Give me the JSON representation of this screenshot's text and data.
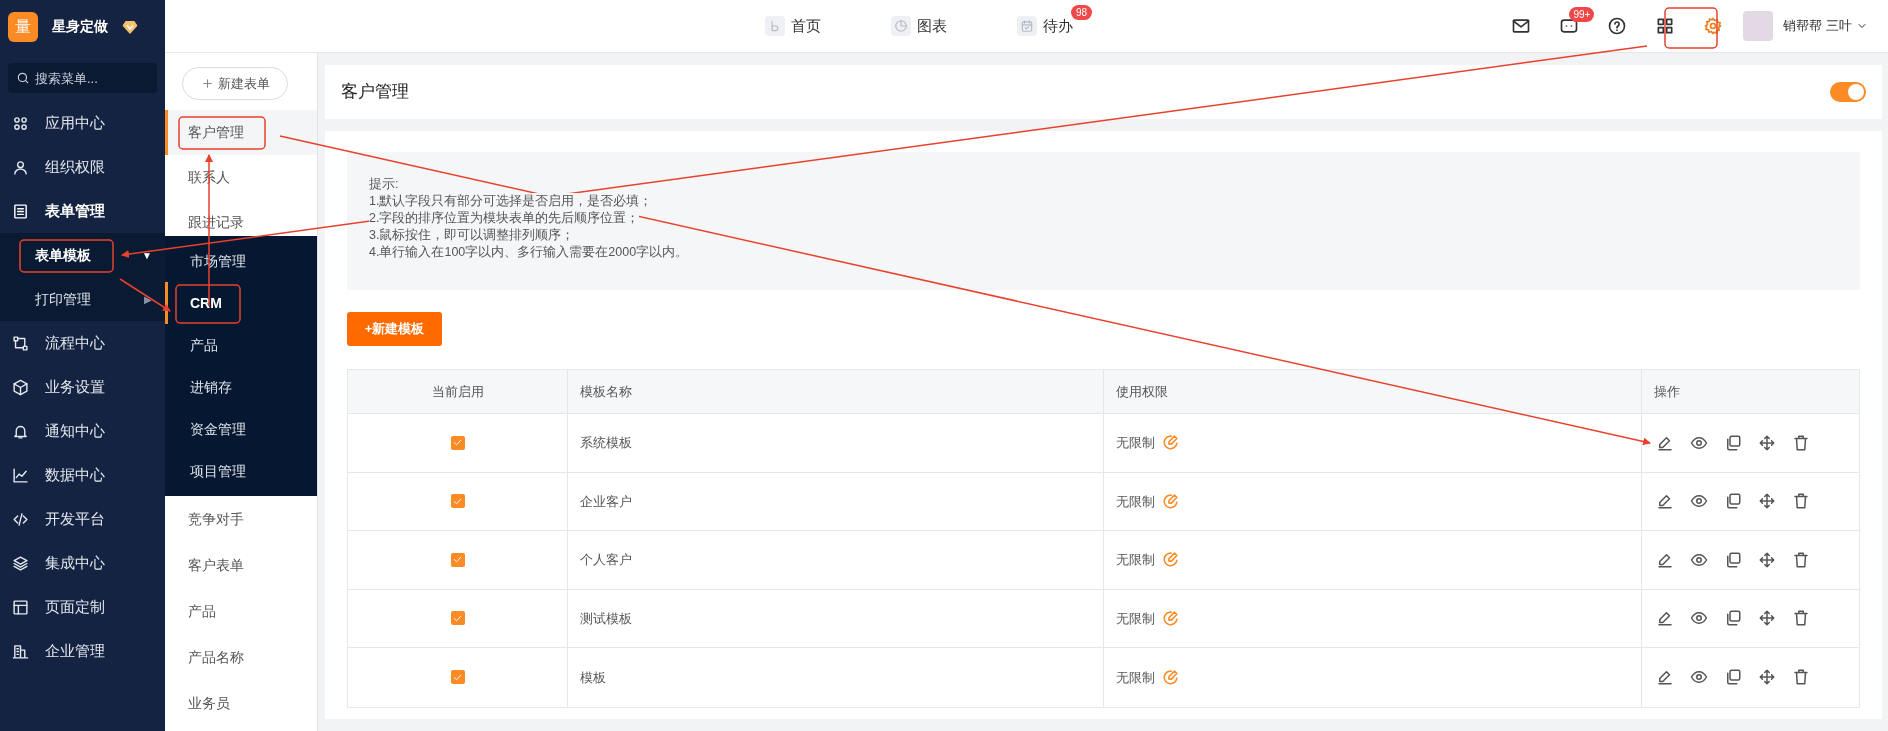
{
  "brand": {
    "logo": "量",
    "name": "星身定做"
  },
  "sidebar": {
    "search": {
      "placeholder": "搜索菜单..."
    },
    "items": [
      {
        "label": "应用中心",
        "expanded": false
      },
      {
        "label": "组织权限",
        "expanded": false
      },
      {
        "label": "表单管理",
        "expanded": true,
        "children": [
          {
            "label": "表单模板",
            "selected": true,
            "caret": "▼"
          },
          {
            "label": "打印管理",
            "selected": false,
            "caret": "▶"
          }
        ]
      },
      {
        "label": "流程中心",
        "expanded": false
      },
      {
        "label": "业务设置",
        "expanded": false
      },
      {
        "label": "通知中心",
        "expanded": false
      },
      {
        "label": "数据中心",
        "expanded": false
      },
      {
        "label": "开发平台",
        "expanded": false
      },
      {
        "label": "集成中心",
        "expanded": false
      },
      {
        "label": "页面定制",
        "expanded": false
      },
      {
        "label": "企业管理",
        "expanded": false
      }
    ]
  },
  "topbar": {
    "nav": [
      {
        "label": "首页"
      },
      {
        "label": "图表"
      },
      {
        "label": "待办",
        "badge": "98"
      }
    ],
    "message_badge": "99+",
    "user": "销帮帮 三叶"
  },
  "form_list": {
    "new_button": "新建表单",
    "upper_items": [
      {
        "label": "客户管理",
        "selected": true
      },
      {
        "label": "联系人",
        "selected": false
      },
      {
        "label": "跟进记录",
        "selected": false
      }
    ],
    "lower_items": [
      {
        "label": "竞争对手",
        "selected": false
      },
      {
        "label": "客户表单",
        "selected": false
      },
      {
        "label": "产品",
        "selected": false
      },
      {
        "label": "产品名称",
        "selected": false
      },
      {
        "label": "业务员",
        "selected": false
      }
    ]
  },
  "flyout": {
    "items": [
      {
        "label": "市场管理",
        "selected": false
      },
      {
        "label": "CRM",
        "selected": true
      },
      {
        "label": "产品",
        "selected": false
      },
      {
        "label": "进销存",
        "selected": false
      },
      {
        "label": "资金管理",
        "selected": false
      },
      {
        "label": "项目管理",
        "selected": false
      }
    ]
  },
  "page": {
    "title": "客户管理",
    "toggle_on": true,
    "hint": [
      "提示:",
      "1.默认字段只有部分可选择是否启用，是否必填；",
      "2.字段的排序位置为模块表单的先后顺序位置；",
      "3.鼠标按住，即可以调整排列顺序；",
      "4.单行输入在100字以内、多行输入需要在2000字以内。"
    ],
    "new_template_button": "+新建模板",
    "table": {
      "columns": [
        "当前启用",
        "模板名称",
        "使用权限",
        "操作"
      ],
      "rows": [
        {
          "enabled": true,
          "name": "系统模板",
          "permission": "无限制"
        },
        {
          "enabled": true,
          "name": "企业客户",
          "permission": "无限制"
        },
        {
          "enabled": true,
          "name": "个人客户",
          "permission": "无限制"
        },
        {
          "enabled": true,
          "name": "测试模板",
          "permission": "无限制"
        },
        {
          "enabled": true,
          "name": "模板",
          "permission": "无限制"
        }
      ]
    }
  }
}
